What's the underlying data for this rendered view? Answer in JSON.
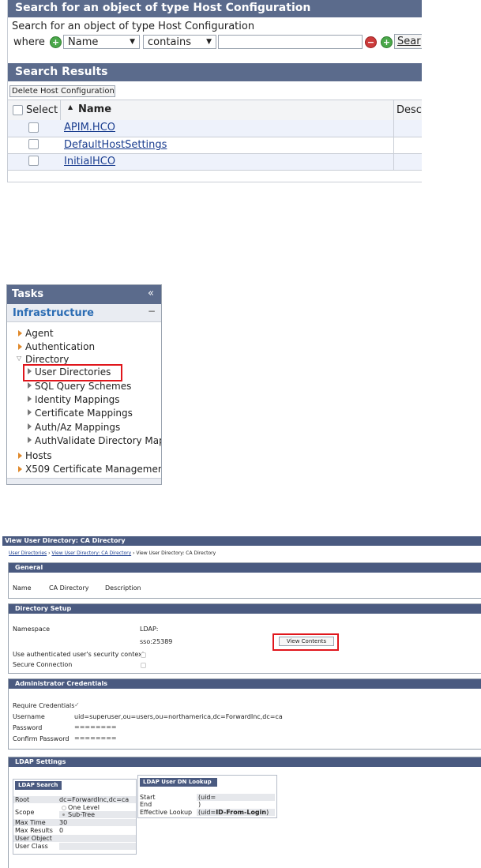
{
  "search_panel": {
    "title": "Search for an object of type Host Configuration",
    "subtitle": "Search for an object of type Host Configuration",
    "where_label": "where",
    "field_select": "Name",
    "operator_select": "contains",
    "value_input": "",
    "search_button": "Sear",
    "results_title": "Search Results",
    "delete_button": "Delete Host Configuration",
    "columns": {
      "select": "Select",
      "name": "Name",
      "desc": "Desc"
    },
    "rows": [
      {
        "name": "APIM.HCO"
      },
      {
        "name": "DefaultHostSettings"
      },
      {
        "name": "InitialHCO"
      }
    ]
  },
  "tasks_panel": {
    "title": "Tasks",
    "collapse_glyph": "«",
    "section": "Infrastructure",
    "section_glyph": "−",
    "items": {
      "agent": "Agent",
      "authentication": "Authentication",
      "directory": "Directory",
      "user_directories": "User Directories",
      "sql_query_schemes": "SQL Query Schemes",
      "identity_mappings": "Identity Mappings",
      "certificate_mappings": "Certificate Mappings",
      "authaz_mappings": "Auth/Az Mappings",
      "authvalidate": "AuthValidate Directory Mappings",
      "hosts": "Hosts",
      "x509": "X509 Certificate Management"
    }
  },
  "view_panel": {
    "title": "View User Directory: CA Directory",
    "breadcrumb": [
      "User Directories",
      "View User Directory: CA Directory",
      "View User Directory: CA Directory"
    ],
    "breadcrumb_sep": "›",
    "general": {
      "title": "General",
      "name_label": "Name",
      "name_value": "CA Directory",
      "description_label": "Description"
    },
    "directory_setup": {
      "title": "Directory Setup",
      "namespace_label": "Namespace",
      "namespace_value": "LDAP:",
      "server_value": "sso:25389",
      "view_contents": "View Contents",
      "use_auth_label": "Use authenticated user's security context",
      "secure_label": "Secure Connection"
    },
    "admin": {
      "title": "Administrator Credentials",
      "require_label": "Require Credentials",
      "require_check": "✓",
      "username_label": "Username",
      "username_value": "uid=superuser,ou=users,ou=northamerica,dc=ForwardInc,dc=ca",
      "password_label": "Password",
      "password_value": "========",
      "confirm_label": "Confirm Password",
      "confirm_value": "========"
    },
    "ldap": {
      "title": "LDAP Settings",
      "search_title": "LDAP Search",
      "root_label": "Root",
      "root_value": "dc=ForwardInc,dc=ca",
      "scope_label": "Scope",
      "scope_one": "One Level",
      "scope_sub": "Sub-Tree",
      "max_time_label": "Max Time",
      "max_time_value": "30",
      "max_results_label": "Max Results",
      "max_results_value": "0",
      "user_object_label": "User Object",
      "user_class_label": "User Class",
      "lookup_title": "LDAP User DN Lookup",
      "start_label": "Start",
      "start_value": "(uid=",
      "end_label": "End",
      "end_value": ")",
      "effective_label": "Effective Lookup",
      "effective_prefix": "(uid=",
      "effective_bold": "ID-From-Login",
      "effective_suffix": ")"
    }
  }
}
